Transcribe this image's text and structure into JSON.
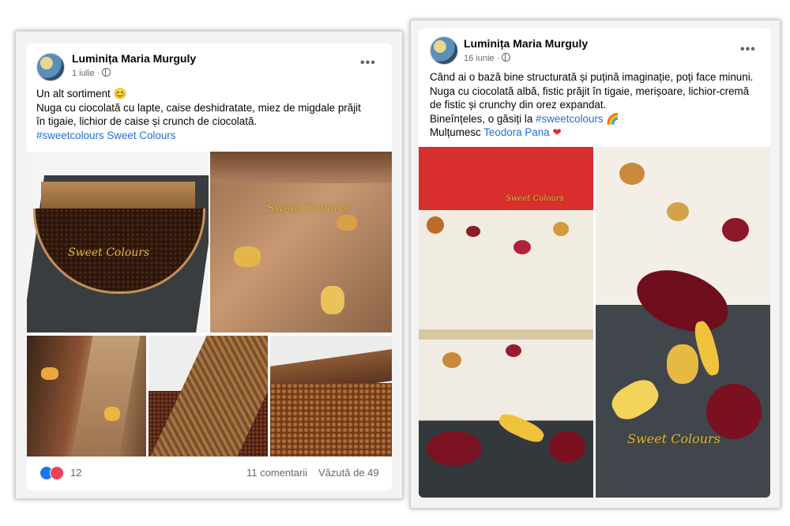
{
  "post_left": {
    "author": "Luminița Maria Murguly",
    "date": "1 iulie ·",
    "menu_icon": "•••",
    "lines": [
      "Un alt sortiment 😊",
      "Nuga cu ciocolată cu lapte, caise deshidratate, miez de migdale prăjit",
      "în tigaie, lichior de caise și crunch de ciocolată."
    ],
    "hashtag": "#sweetcolours",
    "page_link": "Sweet Colours",
    "watermark": "Sweet Colours",
    "reactions_count": "12",
    "comments": "11 comentarii",
    "views": "Văzută de 49"
  },
  "post_right": {
    "author": "Luminița Maria Murguly",
    "date": "16 iunie ·",
    "menu_icon": "•••",
    "lines": [
      "Când ai o bază bine structurată și puțină imaginație, poți face minuni.",
      "Nuga cu ciocolată albă, fistic prăjit în tigaie, merișoare, lichior-cremă",
      "de fistic și crunchy din orez expandat."
    ],
    "line4_prefix": "Bineînțeles, o găsiți la",
    "line4_hashtag": "#sweetcolours",
    "line4_emoji": "🌈",
    "line5_prefix": "Mulțumesc",
    "line5_link": "Teodora Pana",
    "line5_emoji": "❤",
    "watermark": "Sweet Colours"
  },
  "colors": {
    "link": "#216fdb",
    "like_blue": "#1877f2",
    "love_red": "#f33e58",
    "meta_gray": "#65676b"
  },
  "icons": [
    "globe-icon",
    "more-options-icon",
    "like-reaction-icon",
    "love-reaction-icon"
  ]
}
